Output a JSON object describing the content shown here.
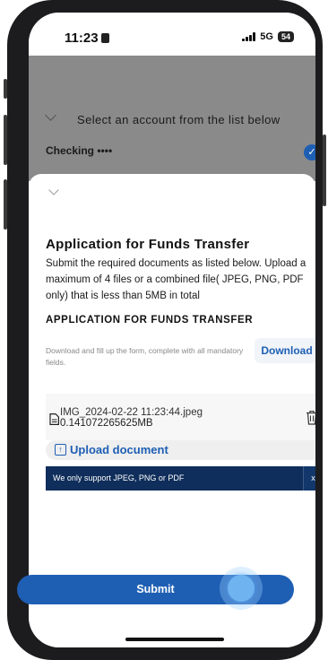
{
  "status_bar": {
    "time": "11:23",
    "network": "5G",
    "battery": "54"
  },
  "account_list": {
    "prompt": "Select an account from the list below",
    "account": "Checking ••••"
  },
  "application": {
    "title": "Application for Funds Transfer",
    "description": "Submit the required documents as listed below. Upload a maximum of 4 files or a combined file( JPEG, PNG, PDF only) that is less than 5MB in total"
  },
  "form": {
    "title": "APPLICATION FOR FUNDS TRANSFER",
    "help": "Download and fill up the form, complete with all mandatory fields.",
    "download_label": "Download"
  },
  "uploaded_file": {
    "name": "IMG_2024-02-22 11:23:44.jpeg",
    "size": "0.141072265625MB"
  },
  "upload": {
    "label": "Upload document"
  },
  "toast": {
    "message": "We only support JPEG, PNG or PDF",
    "close_label": "x"
  },
  "submit": {
    "label": "Submit"
  },
  "colors": {
    "accent": "#1e5fb4",
    "toast": "#0f2e5b"
  }
}
